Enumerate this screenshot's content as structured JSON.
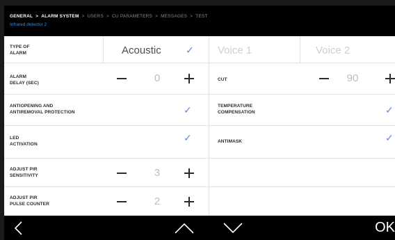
{
  "breadcrumb": {
    "items": [
      {
        "label": "GENERAL",
        "active": true
      },
      {
        "label": "ALARM SYSTEM",
        "active": true
      },
      {
        "label": "USERS",
        "active": false
      },
      {
        "label": "CU PARAMETERS",
        "active": false
      },
      {
        "label": "MESSAGES",
        "active": false
      },
      {
        "label": "TEST",
        "active": false
      }
    ],
    "separator": ">"
  },
  "subtitle": "Infrared detector 2",
  "rows": {
    "type_of_alarm": {
      "label_line1": "TYPE OF",
      "label_line2": "ALARM",
      "options": [
        "Acoustic",
        "Voice 1",
        "Voice 2"
      ],
      "selected": "Acoustic"
    },
    "alarm_delay": {
      "label_line1": "ALARM",
      "label_line2": "DELAY (SEC)",
      "value": "0"
    },
    "cut": {
      "label": "CUT",
      "value": "90"
    },
    "antiopening": {
      "label_line1": "ANTIOPENING AND",
      "label_line2": "ANTIREMOVAL PROTECTION",
      "checked": true
    },
    "temperature_compensation": {
      "label_line1": "TEMPERATURE",
      "label_line2": "COMPENSATION",
      "checked": true
    },
    "led_activation": {
      "label_line1": "LED",
      "label_line2": "ACTIVATION",
      "checked": true
    },
    "antimask": {
      "label": "ANTIMASK",
      "checked": true
    },
    "pir_sensitivity": {
      "label_line1": "ADJUST PIR",
      "label_line2": "SENSITIVITY",
      "value": "3"
    },
    "pir_pulse_counter": {
      "label_line1": "ADJUST PIR",
      "label_line2": "PULSE COUNTER",
      "value": "2"
    }
  },
  "footer": {
    "back_icon": "chevron-left-icon",
    "up_icon": "chevron-up-icon",
    "down_icon": "chevron-down-icon",
    "ok_label": "OK"
  },
  "colors": {
    "accent": "#5e8fd0",
    "subtitle": "#3a8ad6",
    "background": "#000000",
    "panel": "#ffffff"
  }
}
